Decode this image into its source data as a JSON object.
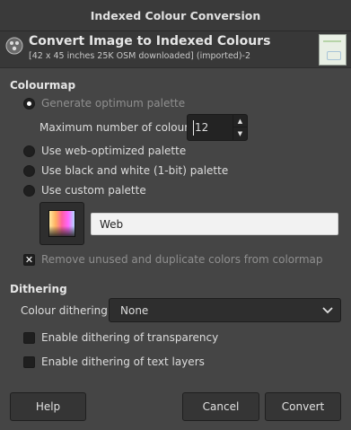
{
  "window": {
    "title": "Indexed Colour Conversion"
  },
  "header": {
    "title": "Convert Image to Indexed Colours",
    "subtitle": "[42 x 45 inches 25K OSM downloaded] (imported)-2",
    "icon": "gimp-wilber-icon"
  },
  "colormap": {
    "section_title": "Colourmap",
    "options": [
      {
        "label": "Generate optimum palette",
        "selected": true,
        "dimmed": true
      },
      {
        "label": "Use web-optimized palette",
        "selected": false
      },
      {
        "label": "Use black and white (1-bit) palette",
        "selected": false
      },
      {
        "label": "Use custom palette",
        "selected": false
      }
    ],
    "max_colours": {
      "label": "Maximum number of colours:",
      "value": "12"
    },
    "custom_palette_name": "Web",
    "remove_unused": {
      "label": "Remove unused and duplicate colors from colormap",
      "checked": true,
      "dimmed": true
    }
  },
  "dithering": {
    "section_title": "Dithering",
    "colour_dithering_label": "Colour dithering:",
    "colour_dithering_value": "None",
    "transparency": {
      "label": "Enable dithering of transparency",
      "checked": false
    },
    "text_layers": {
      "label": "Enable dithering of text layers",
      "checked": false
    }
  },
  "buttons": {
    "help": "Help",
    "cancel": "Cancel",
    "convert": "Convert"
  }
}
